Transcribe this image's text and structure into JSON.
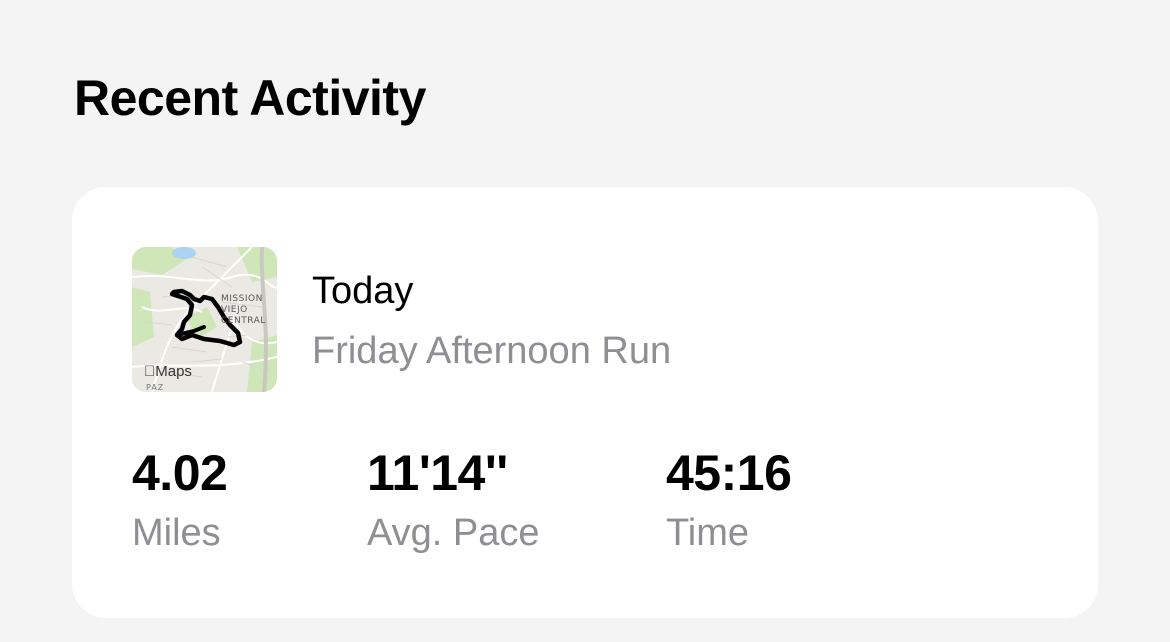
{
  "section": {
    "title": "Recent Activity"
  },
  "activity": {
    "date": "Today",
    "name": "Friday Afternoon Run",
    "map": {
      "watermark": "Maps",
      "watermark_icon": "apple-logo-icon",
      "area_label_lines": [
        "MISSION",
        "VIEJO",
        "CENTRAL"
      ],
      "bottom_label": "PAZ",
      "route_color": "#000000",
      "park_color": "#cfe6b8",
      "water_color": "#a9d3f0"
    },
    "stats": [
      {
        "value": "4.02",
        "label": "Miles"
      },
      {
        "value": "11'14''",
        "label": "Avg. Pace"
      },
      {
        "value": "45:16",
        "label": "Time"
      }
    ]
  }
}
